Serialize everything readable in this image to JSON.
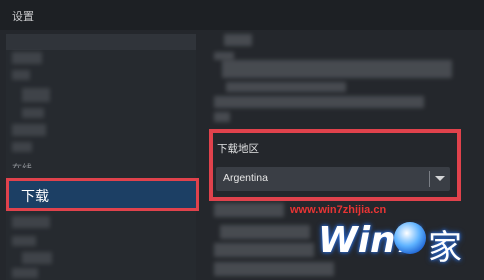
{
  "window": {
    "title": "设置"
  },
  "sidebar": {
    "selected_item": {
      "label": "下载"
    },
    "truncated_label_above": "在线"
  },
  "download_region": {
    "label": "下载地区",
    "selected_value": "Argentina"
  },
  "watermark": {
    "url": "www.win7zhijia.cn",
    "logo_text": "Win7",
    "logo_char": "家"
  },
  "colors": {
    "highlight_border": "#e0424c",
    "selected_item_bg": "#1c3f64",
    "window_bg": "#24272c"
  }
}
